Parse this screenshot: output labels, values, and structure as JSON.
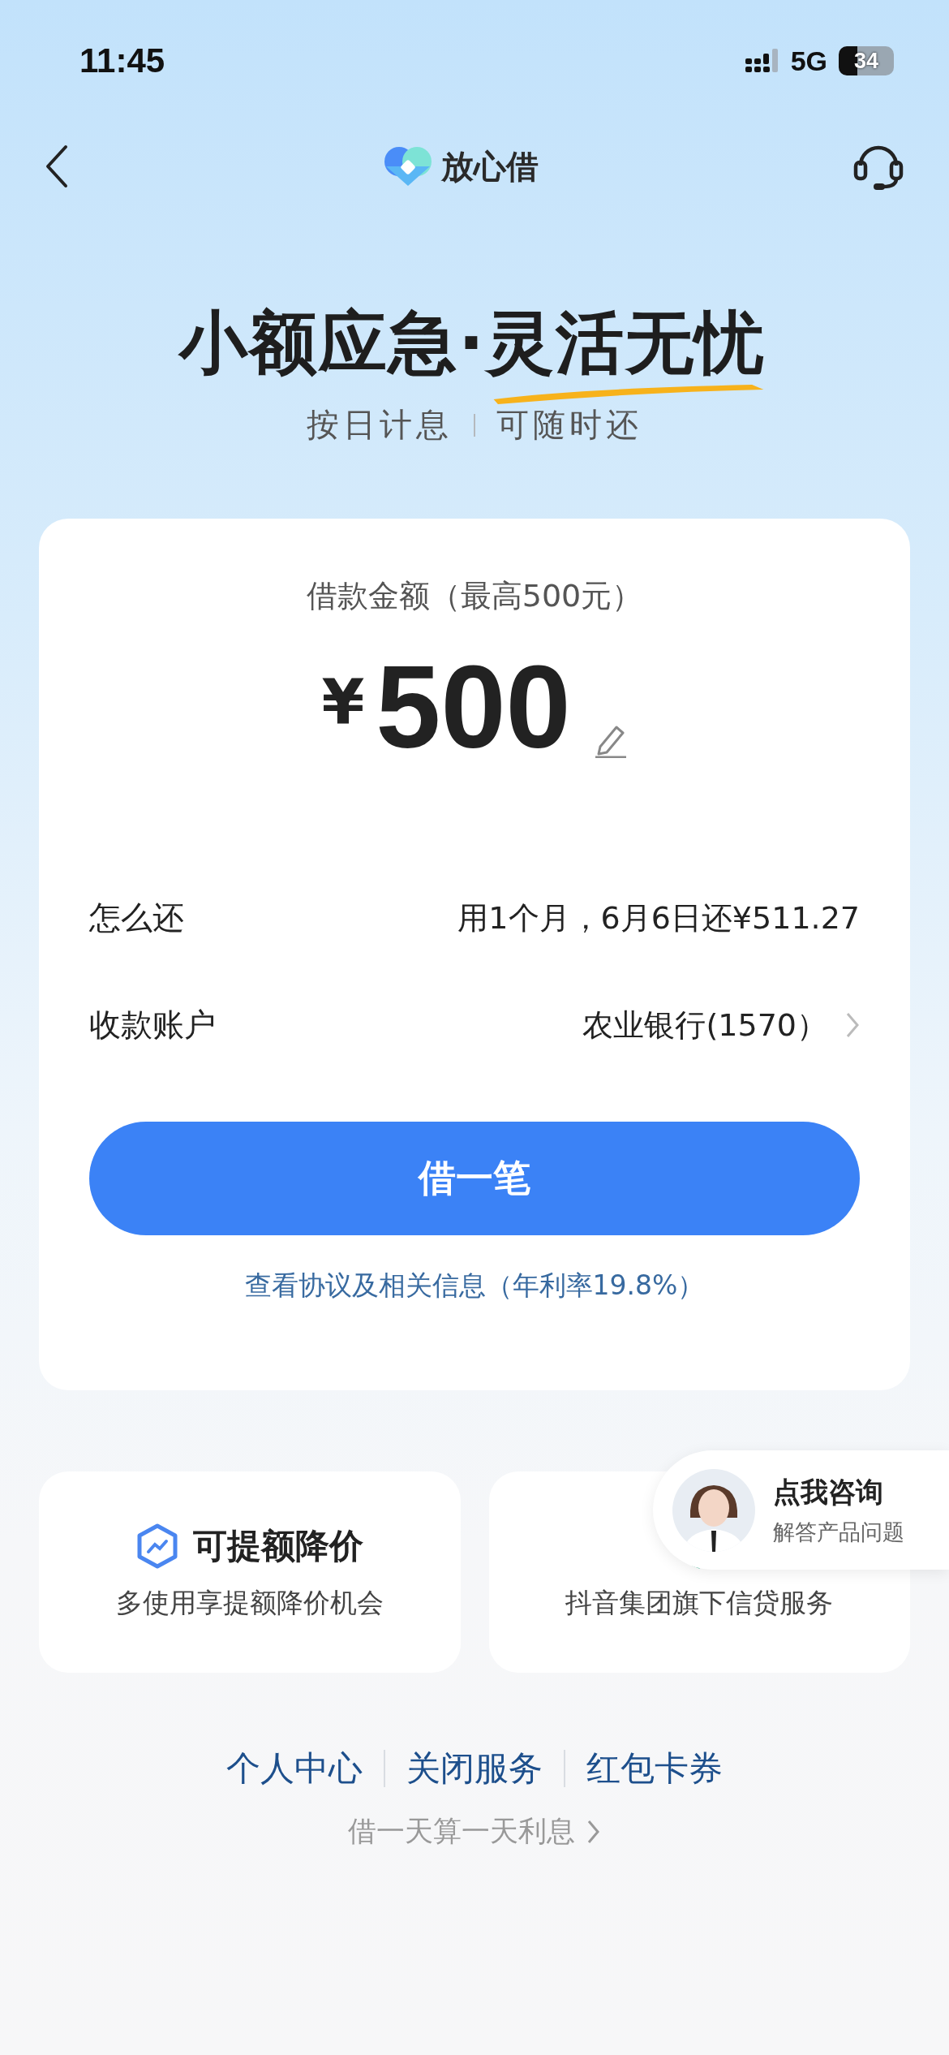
{
  "status_bar": {
    "time": "11:45",
    "network": "5G",
    "battery": "34"
  },
  "nav": {
    "title": "放心借"
  },
  "hero": {
    "headline_plain": "小额应急·",
    "headline_highlight": "灵活无忧",
    "features": [
      "按日计息",
      "可随时还"
    ]
  },
  "loan_card": {
    "amount_label": "借款金额（最高500元）",
    "currency": "¥",
    "amount": "500",
    "rows": [
      {
        "label": "怎么还",
        "value": "用1个月，6月6日还¥511.27",
        "chevron": false
      },
      {
        "label": "收款账户",
        "value": "农业银行(1570）",
        "chevron": true
      }
    ],
    "submit": "借一笔",
    "agreement_link": "查看协议及相关信息（年利率19.8%）"
  },
  "benefits": [
    {
      "kind": "increase",
      "title": "可提额降价",
      "subtitle": "多使用享提额降价机会"
    },
    {
      "kind": "secure",
      "subtitle": "抖音集团旗下信贷服务"
    }
  ],
  "consult_bubble": {
    "title": "点我咨询",
    "subtitle": "解答产品问题"
  },
  "footer_links": [
    "个人中心",
    "关闭服务",
    "红包卡券"
  ],
  "footer_note": "借一天算一天利息"
}
